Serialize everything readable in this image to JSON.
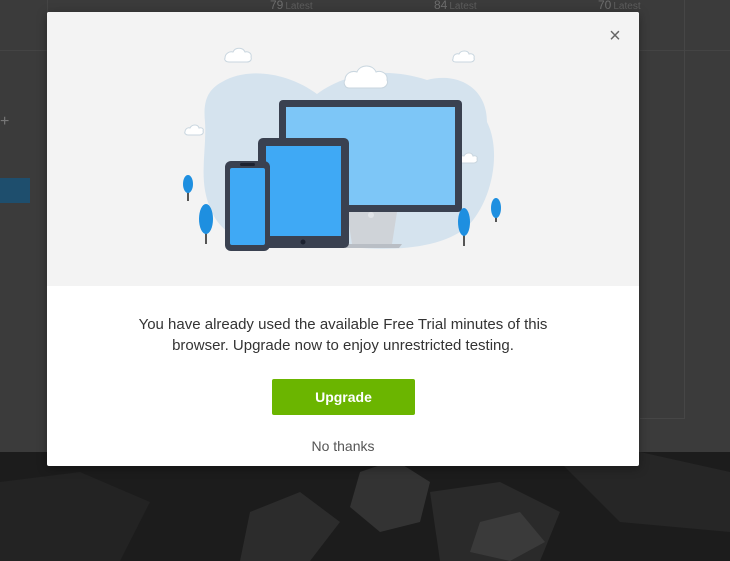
{
  "background": {
    "stats": [
      {
        "value": "79",
        "label": "Latest"
      },
      {
        "value": "84",
        "label": "Latest"
      },
      {
        "value": "70",
        "label": "Latest"
      }
    ],
    "plus_glyph": "+"
  },
  "modal": {
    "close_glyph": "×",
    "illustration": "devices-cloud-illustration",
    "message": "You have already used the available Free Trial minutes of this browser. Upgrade now to enjoy unrestricted testing.",
    "upgrade_label": "Upgrade",
    "dismiss_label": "No thanks"
  },
  "colors": {
    "accent_green": "#6bb500",
    "device_blue": "#3fa9f5",
    "screen_blue": "#7dc6f7",
    "device_frame": "#3a4150",
    "blob": "#d5e3ee"
  }
}
